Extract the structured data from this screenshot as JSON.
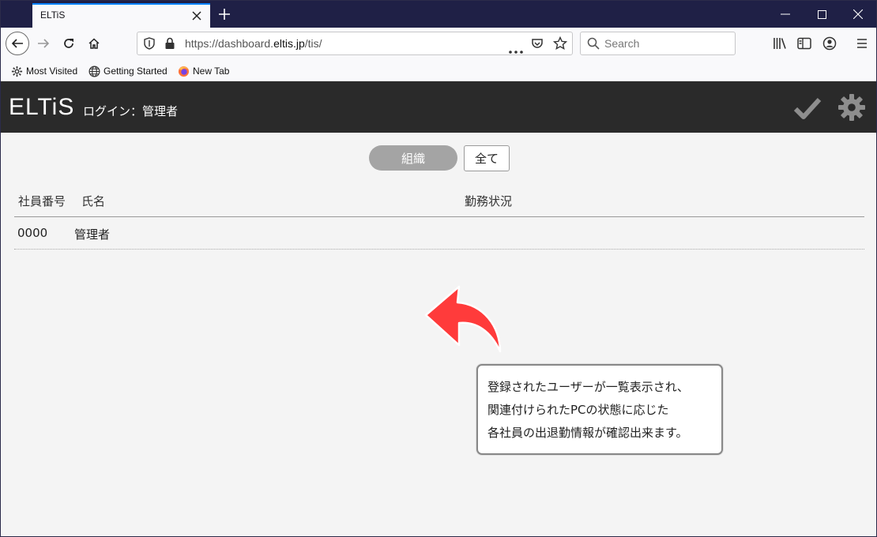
{
  "browser": {
    "tab_title": "ELTiS",
    "url_prefix": "https://dashboard.",
    "url_host": "eltis.jp",
    "url_suffix": "/tis/",
    "search_placeholder": "Search",
    "bookmarks": [
      "Most Visited",
      "Getting Started",
      "New Tab"
    ]
  },
  "app": {
    "logo": "ELTiS",
    "login_label": "ログイン：管理者"
  },
  "filters": {
    "org_label": "組織",
    "all_label": "全て"
  },
  "table": {
    "headers": [
      "社員番号",
      "氏名",
      "勤務状況"
    ],
    "rows": [
      {
        "id": "0000",
        "name": "管理者",
        "status": ""
      }
    ]
  },
  "annotation": {
    "arrow_color": "#ff3b3b",
    "lines": [
      "登録されたユーザーが一覧表示され、",
      "関連付けられたPCの状態に応じた",
      "各社員の出退勤情報が確認出来ます。"
    ]
  },
  "colors": {
    "titlebar": "#1f2046",
    "app_header": "#2a2a2a",
    "accent_tab": "#0a84ff"
  }
}
